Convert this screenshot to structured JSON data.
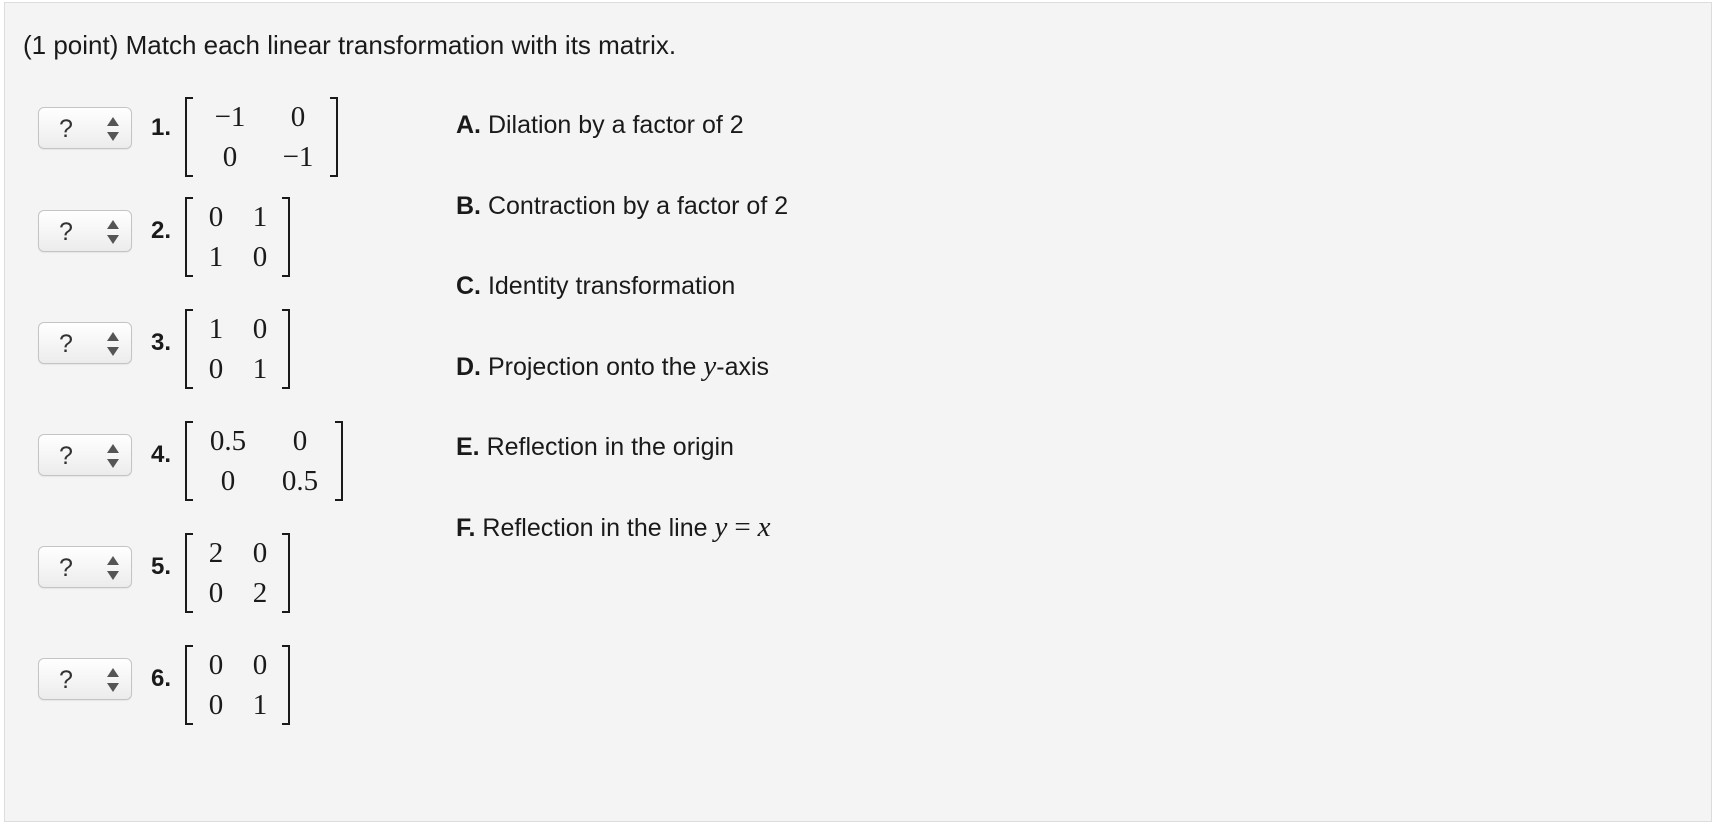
{
  "problem": {
    "title": "(1 point) Match each linear transformation with its matrix."
  },
  "items": [
    {
      "select_value": "?",
      "number": "1.",
      "matrix": [
        [
          "−1",
          "0"
        ],
        [
          "0",
          "−1"
        ]
      ]
    },
    {
      "select_value": "?",
      "number": "2.",
      "matrix": [
        [
          "0",
          "1"
        ],
        [
          "1",
          "0"
        ]
      ]
    },
    {
      "select_value": "?",
      "number": "3.",
      "matrix": [
        [
          "1",
          "0"
        ],
        [
          "0",
          "1"
        ]
      ]
    },
    {
      "select_value": "?",
      "number": "4.",
      "matrix": [
        [
          "0.5",
          "0"
        ],
        [
          "0",
          "0.5"
        ]
      ]
    },
    {
      "select_value": "?",
      "number": "5.",
      "matrix": [
        [
          "2",
          "0"
        ],
        [
          "0",
          "2"
        ]
      ]
    },
    {
      "select_value": "?",
      "number": "6.",
      "matrix": [
        [
          "0",
          "0"
        ],
        [
          "0",
          "1"
        ]
      ]
    }
  ],
  "options": [
    {
      "letter": "A.",
      "text": "Dilation by a factor of 2"
    },
    {
      "letter": "B.",
      "text": "Contraction by a factor of 2"
    },
    {
      "letter": "C.",
      "text": "Identity transformation"
    },
    {
      "letter": "D.",
      "text_before": "Projection onto the",
      "math": "y",
      "text_after": "-axis"
    },
    {
      "letter": "E.",
      "text": "Reflection in the origin"
    },
    {
      "letter": "F.",
      "text_before": "Reflection in the line",
      "math": "y",
      "equals": "=",
      "math2": "x"
    }
  ],
  "icons": {
    "select_arrows": "updown-arrows-icon"
  },
  "colors": {
    "panel_background": "#f4f4f4",
    "select_border": "#c4c4c4",
    "text": "#1a1a1a"
  }
}
